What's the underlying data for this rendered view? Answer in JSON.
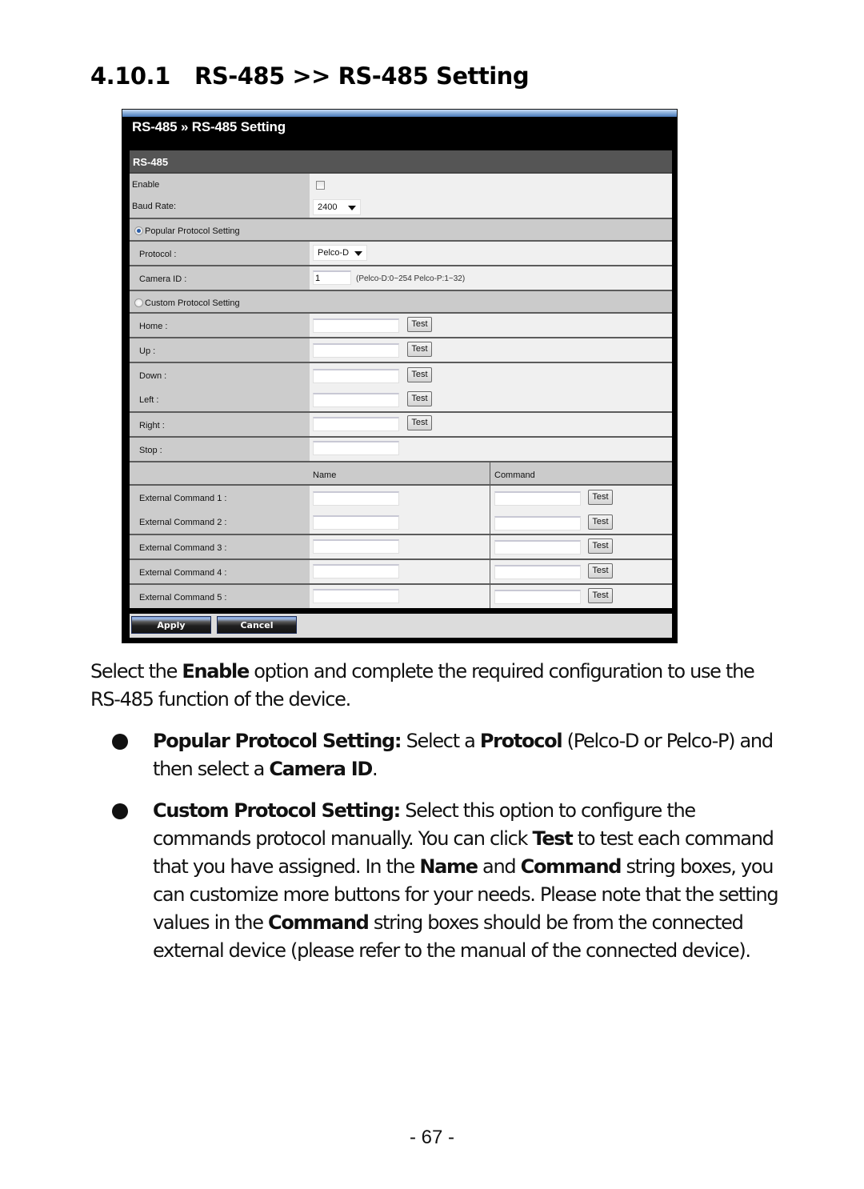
{
  "heading": {
    "number": "4.10.1",
    "title": "RS-485 >> RS-485 Setting"
  },
  "screenshot": {
    "title": "RS-485 » RS-485 Setting",
    "panel_header": "RS-485",
    "enable": {
      "label": "Enable",
      "checked": false
    },
    "baud_rate": {
      "label": "Baud Rate:",
      "value": "2400"
    },
    "popular": {
      "label": "Popular Protocol Setting",
      "selected": true,
      "protocol": {
        "label": "Protocol :",
        "value": "Pelco-D"
      },
      "camera_id": {
        "label": "Camera ID :",
        "value": "1",
        "hint": "(Pelco-D:0~254 Pelco-P:1~32)"
      }
    },
    "custom": {
      "label": "Custom Protocol Setting",
      "selected": false,
      "commands": [
        {
          "label": "Home :",
          "value": "",
          "test": "Test"
        },
        {
          "label": "Up :",
          "value": "",
          "test": "Test"
        },
        {
          "label": "Down :",
          "value": "",
          "test": "Test"
        },
        {
          "label": "Left :",
          "value": "",
          "test": "Test"
        },
        {
          "label": "Right :",
          "value": "",
          "test": "Test"
        },
        {
          "label": "Stop :",
          "value": ""
        }
      ],
      "columns": {
        "name": "Name",
        "command": "Command"
      },
      "external": [
        {
          "label": "External Command 1 :",
          "name": "",
          "command": "",
          "test": "Test"
        },
        {
          "label": "External Command 2 :",
          "name": "",
          "command": "",
          "test": "Test"
        },
        {
          "label": "External Command 3 :",
          "name": "",
          "command": "",
          "test": "Test"
        },
        {
          "label": "External Command 4 :",
          "name": "",
          "command": "",
          "test": "Test"
        },
        {
          "label": "External Command 5 :",
          "name": "",
          "command": "",
          "test": "Test"
        }
      ]
    },
    "apply_label": "Apply",
    "cancel_label": "Cancel"
  },
  "body": {
    "intro": {
      "t1": "Select the ",
      "b1": "Enable",
      "t2": " option and complete the required configuration to use the RS-485 function of the device."
    },
    "bullet1": {
      "b1": "Popular Protocol Setting:",
      "t1": " Select a ",
      "b2": "Protocol",
      "t2": " (Pelco-D or Pelco-P) and then select a ",
      "b3": "Camera ID",
      "t3": "."
    },
    "bullet2": {
      "b1": "Custom Protocol Setting:",
      "t1": " Select this option to configure the commands protocol manually. You can click ",
      "b2": "Test",
      "t2": " to test each command that you have assigned. In the ",
      "b3": "Name",
      "t3": " and ",
      "b4": "Command",
      "t4": " string boxes, you can customize more buttons for your needs. Please note that the setting values in the ",
      "b5": "Command",
      "t5": " string boxes should be from the connected external device (please refer to the manual of the connected device)."
    }
  },
  "page_number": "- 67 -"
}
